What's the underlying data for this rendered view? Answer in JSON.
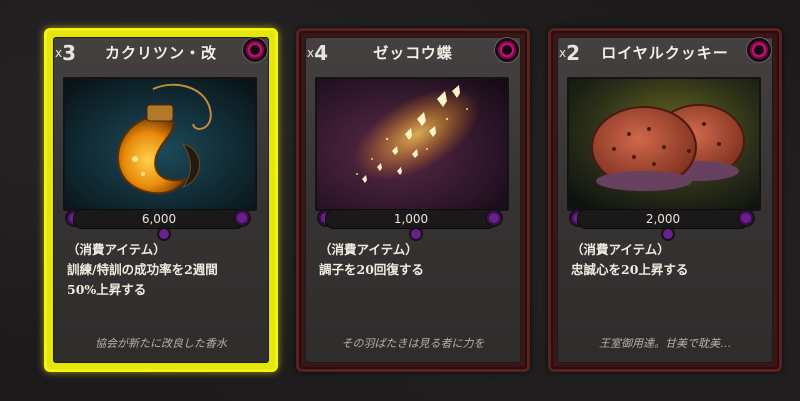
{
  "cards": [
    {
      "quantity_prefix": "x",
      "quantity": "3",
      "name": "カクリツン・改",
      "price": "6,000",
      "category": "（消費アイテム）",
      "description": [
        "訓練/特訓の成功率を2週間",
        "50%上昇する"
      ],
      "flavor": "協会が新たに改良した香水",
      "art_icon": "perfume-bottle-icon",
      "selected": true
    },
    {
      "quantity_prefix": "x",
      "quantity": "4",
      "name": "ゼッコウ蝶",
      "price": "1,000",
      "category": "（消費アイテム）",
      "description": [
        "調子を20回復する"
      ],
      "flavor": "その羽ばたきは見る者に力を",
      "art_icon": "glowing-butterflies-icon",
      "selected": false
    },
    {
      "quantity_prefix": "x",
      "quantity": "2",
      "name": "ロイヤルクッキー",
      "price": "2,000",
      "category": "（消費アイテム）",
      "description": [
        "忠誠心を20上昇する"
      ],
      "flavor": "王室御用達。甘美で耽美…",
      "art_icon": "cookies-icon",
      "selected": false
    }
  ],
  "colors": {
    "selected_frame": "#e6e60a",
    "normal_frame": "#5a2121",
    "gem": "#c8107a",
    "price_dot": "#6a1f8c"
  }
}
